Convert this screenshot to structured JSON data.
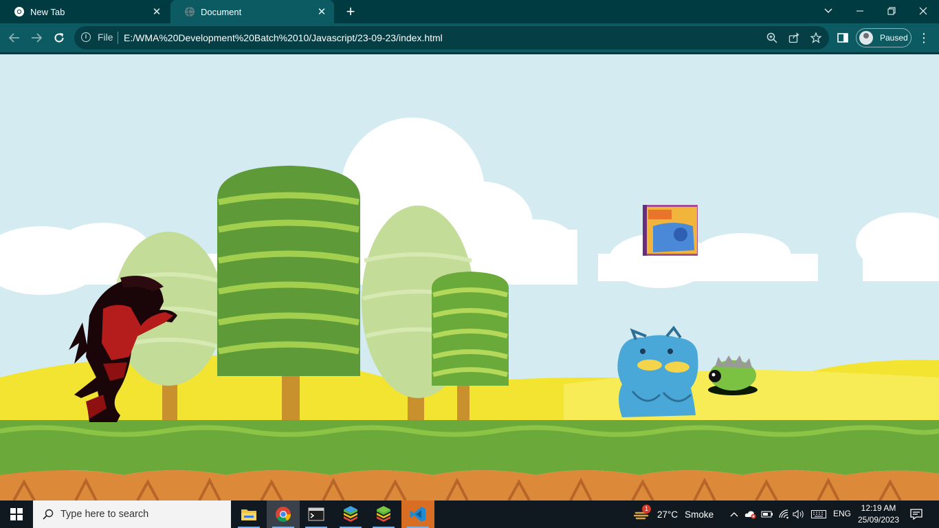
{
  "browser": {
    "tabs": [
      {
        "title": "New Tab",
        "active": false
      },
      {
        "title": "Document",
        "active": true
      }
    ],
    "address": {
      "scheme_label": "File",
      "url": "E:/WMA%20Development%20Batch%2010/Javascript/23-09-23/index.html"
    },
    "profile": {
      "status": "Paused"
    }
  },
  "taskbar": {
    "search_placeholder": "Type here to search",
    "apps": [
      "file-explorer",
      "chrome",
      "terminal",
      "bluestacks",
      "bluestacks-x",
      "vscode"
    ],
    "weather": {
      "temperature": "27°C",
      "condition": "Smoke",
      "alert_count": "1"
    },
    "language": "ENG",
    "clock": {
      "time": "12:19 AM",
      "date": "25/09/2023"
    }
  },
  "colors": {
    "tab_strip": "#003b42",
    "toolbar": "#0c5a62",
    "sky": "#d5ebf2",
    "grass": "#6aa93a",
    "dirt": "#dc8a3a",
    "hills": "#f3e432"
  }
}
